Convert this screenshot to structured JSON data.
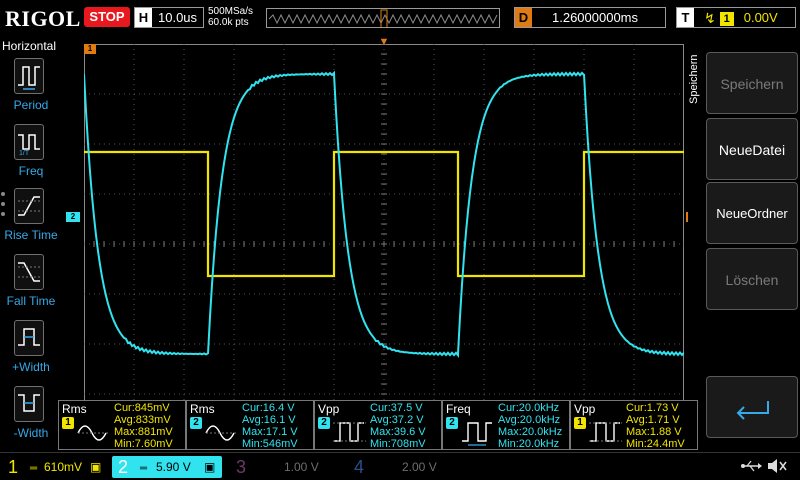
{
  "topbar": {
    "logo": "RIGOL",
    "run_status": "STOP",
    "timebase_letter": "H",
    "timebase_value": "10.0us",
    "sample_rate": "500MSa/s",
    "mem_depth": "60.0k pts",
    "delay_letter": "D",
    "delay_value": "1.26000000ms",
    "trigger_letter": "T",
    "trigger_source": "1",
    "trigger_level": "0.00V"
  },
  "left_menu": {
    "title": "Horizontal",
    "items": [
      {
        "label": "Period",
        "icon": "period-icon"
      },
      {
        "label": "Freq",
        "icon": "freq-icon"
      },
      {
        "label": "Rise Time",
        "icon": "rise-time-icon"
      },
      {
        "label": "Fall Time",
        "icon": "fall-time-icon"
      },
      {
        "label": "+Width",
        "icon": "positive-width-icon"
      },
      {
        "label": "-Width",
        "icon": "negative-width-icon"
      }
    ]
  },
  "markers": {
    "ch1": "1",
    "ch2": "2",
    "trig_level": "T"
  },
  "right_menu": {
    "title": "Speichern",
    "buttons": [
      {
        "label": "Speichern",
        "enabled": false
      },
      {
        "label": "NeueDatei",
        "enabled": true
      },
      {
        "label": "NeueOrdner",
        "enabled": true
      },
      {
        "label": "Löschen",
        "enabled": false
      }
    ],
    "return_icon": "return-arrow-icon"
  },
  "measurements": [
    {
      "type": "Rms",
      "channel": "1",
      "cur": "Cur:845mV",
      "avg": "Avg:833mV",
      "max": "Max:881mV",
      "min": "Min:7.60mV"
    },
    {
      "type": "Rms",
      "channel": "2",
      "cur": "Cur:16.4 V",
      "avg": "Avg:16.1 V",
      "max": "Max:17.1 V",
      "min": "Min:546mV"
    },
    {
      "type": "Vpp",
      "channel": "2",
      "cur": "Cur:37.5 V",
      "avg": "Avg:37.2 V",
      "max": "Max:39.6 V",
      "min": "Min:708mV"
    },
    {
      "type": "Freq",
      "channel": "2",
      "cur": "Cur:20.0kHz",
      "avg": "Avg:20.0kHz",
      "max": "Max:20.0kHz",
      "min": "Min:20.0kHz"
    },
    {
      "type": "Vpp",
      "channel": "1",
      "cur": "Cur:1.73 V",
      "avg": "Avg:1.71 V",
      "max": "Max:1.88 V",
      "min": "Min:24.4mV"
    }
  ],
  "bottom_bar": {
    "channels": [
      {
        "num": "1",
        "scale": "610mV"
      },
      {
        "num": "2",
        "scale": "5.90 V"
      },
      {
        "num": "3",
        "scale": "1.00 V"
      },
      {
        "num": "4",
        "scale": "2.00 V"
      }
    ],
    "usb_icon": "usb-icon",
    "sound_icon": "speaker-muted-icon"
  },
  "colors": {
    "ch1": "#f1e500",
    "ch2": "#30e3ef",
    "ch3": "#d246c7",
    "ch4": "#2c6ff2",
    "stop": "#e8191e",
    "trigger": "#e07b14",
    "menu_accent": "#36a9e8"
  }
}
